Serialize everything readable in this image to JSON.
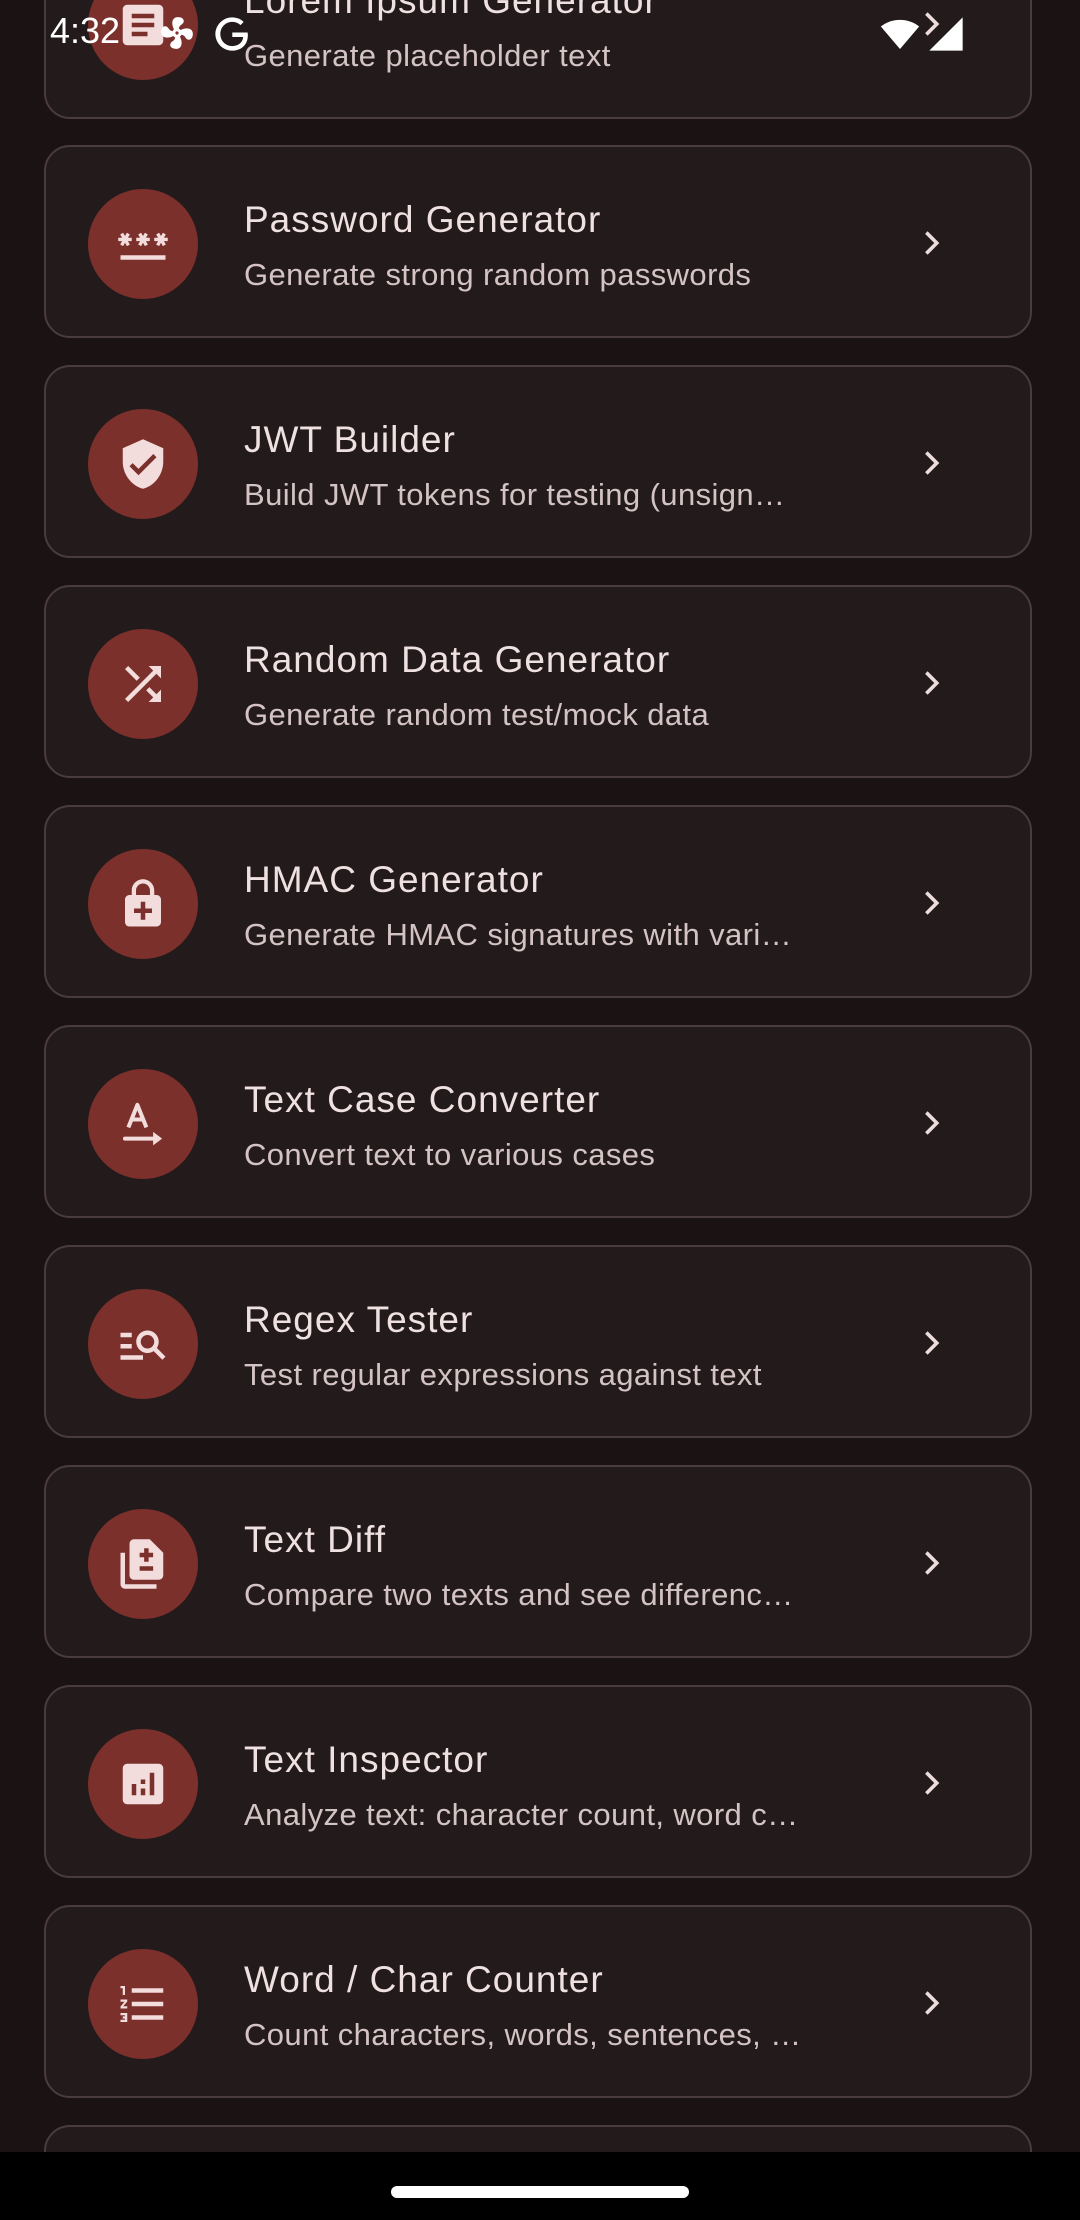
{
  "status_bar": {
    "time": "4:32"
  },
  "colors": {
    "background": "#1b1214",
    "card": "#231a1c",
    "icon_bg": "#7b302b",
    "icon_fg": "#f2dcdc"
  },
  "tools": [
    {
      "title": "Lorem Ipsum Generator",
      "subtitle": "Generate placeholder text",
      "icon": "article-icon"
    },
    {
      "title": "Password Generator",
      "subtitle": "Generate strong random passwords",
      "icon": "password-icon"
    },
    {
      "title": "JWT Builder",
      "subtitle": "Build JWT tokens for testing (unsign…",
      "icon": "verified-shield-icon"
    },
    {
      "title": "Random Data Generator",
      "subtitle": "Generate random test/mock data",
      "icon": "shuffle-icon"
    },
    {
      "title": "HMAC Generator",
      "subtitle": "Generate HMAC signatures with vari…",
      "icon": "enhanced-encryption-icon"
    },
    {
      "title": "Text Case Converter",
      "subtitle": "Convert text to various cases",
      "icon": "text-rotation-icon"
    },
    {
      "title": "Regex Tester",
      "subtitle": "Test regular expressions against text",
      "icon": "manage-search-icon"
    },
    {
      "title": "Text Diff",
      "subtitle": "Compare two texts and see differenc…",
      "icon": "difference-icon"
    },
    {
      "title": "Text Inspector",
      "subtitle": "Analyze text: character count, word c…",
      "icon": "analytics-icon"
    },
    {
      "title": "Word / Char Counter",
      "subtitle": "Count characters, words, sentences, …",
      "icon": "format-list-numbered-icon"
    }
  ]
}
